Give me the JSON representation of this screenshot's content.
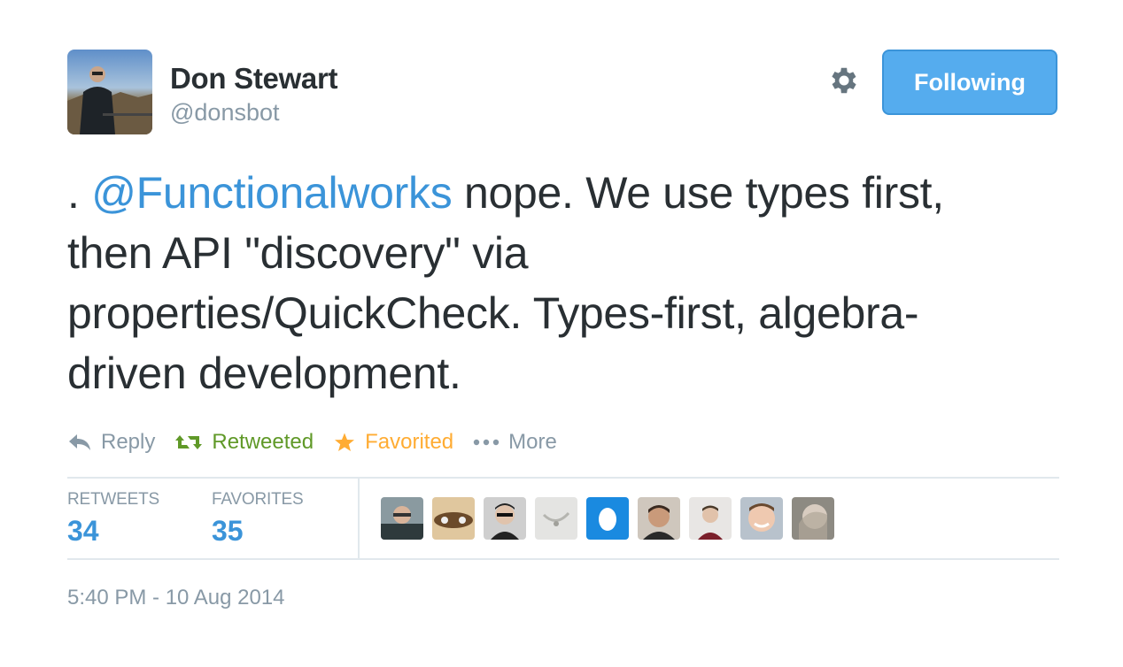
{
  "author": {
    "full_name": "Don Stewart",
    "screen_name": "@donsbot"
  },
  "follow_button": {
    "label": "Following"
  },
  "tweet": {
    "prefix": ". ",
    "mention": "@Functionalworks",
    "line1_rest": " nope. We use types first,",
    "line2": "then API \"discovery\" via",
    "line3": "properties/QuickCheck. Types-first, algebra-",
    "line4": "driven development."
  },
  "actions": {
    "reply": "Reply",
    "retweet": "Retweeted",
    "favorite": "Favorited",
    "more": "More"
  },
  "stats": {
    "retweets_label": "RETWEETS",
    "retweets_count": "34",
    "favorites_label": "FAVORITES",
    "favorites_count": "35"
  },
  "favoriters": [
    {
      "icon": "user-avatar-1"
    },
    {
      "icon": "user-avatar-2"
    },
    {
      "icon": "user-avatar-3"
    },
    {
      "icon": "user-avatar-4"
    },
    {
      "icon": "default-egg-avatar"
    },
    {
      "icon": "user-avatar-6"
    },
    {
      "icon": "user-avatar-7"
    },
    {
      "icon": "user-avatar-8"
    },
    {
      "icon": "user-avatar-9"
    }
  ],
  "timestamp": "5:40 PM - 10 Aug 2014",
  "colors": {
    "accent_blue": "#3b94d9",
    "button_blue": "#55acee",
    "retweet_green": "#609928",
    "favorite_orange": "#ffac33",
    "muted_gray": "#8899a6",
    "text_dark": "#292f33"
  }
}
